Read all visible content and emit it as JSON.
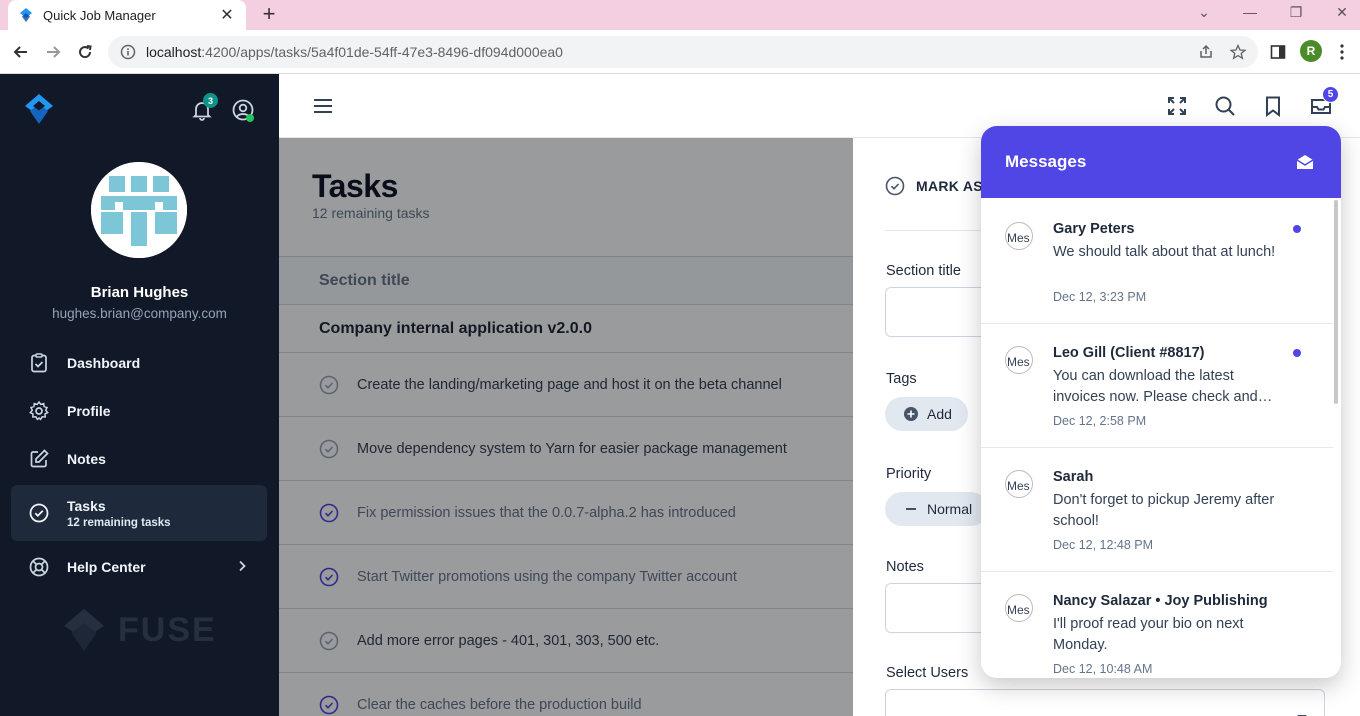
{
  "browser": {
    "tab_title": "Quick Job Manager",
    "url_host": "localhost",
    "url_path": ":4200/apps/tasks/5a4f01de-54ff-47e3-8496-df094d000ea0",
    "profile_initial": "R"
  },
  "sidebar": {
    "notification_count": "3",
    "user_name": "Brian Hughes",
    "user_email": "hughes.brian@company.com",
    "items": [
      {
        "label": "Dashboard",
        "icon": "clipboard-check-icon"
      },
      {
        "label": "Profile",
        "icon": "gear-icon"
      },
      {
        "label": "Notes",
        "icon": "pencil-square-icon"
      },
      {
        "label": "Tasks",
        "subtitle": "12 remaining tasks",
        "icon": "check-circle-icon"
      },
      {
        "label": "Help Center",
        "icon": "lifebuoy-icon"
      }
    ],
    "watermark": "FUSE"
  },
  "header": {
    "mail_badge": "5"
  },
  "tasks": {
    "title": "Tasks",
    "subtitle": "12 remaining tasks",
    "section_label": "Section title",
    "section_title": "Company internal application v2.0.0",
    "items": [
      {
        "text": "Create the landing/marketing page and host it on the beta channel",
        "done": false
      },
      {
        "text": "Move dependency system to Yarn for easier package management",
        "done": false
      },
      {
        "text": "Fix permission issues that the 0.0.7-alpha.2 has introduced",
        "done": true
      },
      {
        "text": "Start Twitter promotions using the company Twitter account",
        "done": true
      },
      {
        "text": "Add more error pages - 401, 301, 303, 500 etc.",
        "done": false
      },
      {
        "text": "Clear the caches before the production build",
        "done": true
      }
    ]
  },
  "details": {
    "mark_label": "MARK AS",
    "section_label": "Section title",
    "tags_label": "Tags",
    "add_label": "Add",
    "priority_label": "Priority",
    "priority_value": "Normal",
    "notes_label": "Notes",
    "users_label": "Select Users"
  },
  "messages": {
    "title": "Messages",
    "avatar_alt": "Mes",
    "items": [
      {
        "name": "Gary Peters",
        "text": "We should talk about that at lunch!",
        "time": "Dec 12, 3:23 PM",
        "unread": true
      },
      {
        "name": "Leo Gill (Client #8817)",
        "text": "You can download the latest invoices now. Please check and…",
        "time": "Dec 12, 2:58 PM",
        "unread": true
      },
      {
        "name": "Sarah",
        "text": "Don't forget to pickup Jeremy after school!",
        "time": "Dec 12, 12:48 PM",
        "unread": false
      },
      {
        "name": "Nancy Salazar • Joy Publishing",
        "text": "I'll proof read your bio on next Monday.",
        "time": "Dec 12, 10:48 AM",
        "unread": false
      }
    ]
  },
  "colors": {
    "sidebar_bg": "#111827",
    "accent": "#4f46e5",
    "tab_strip": "#f4cfe1"
  }
}
